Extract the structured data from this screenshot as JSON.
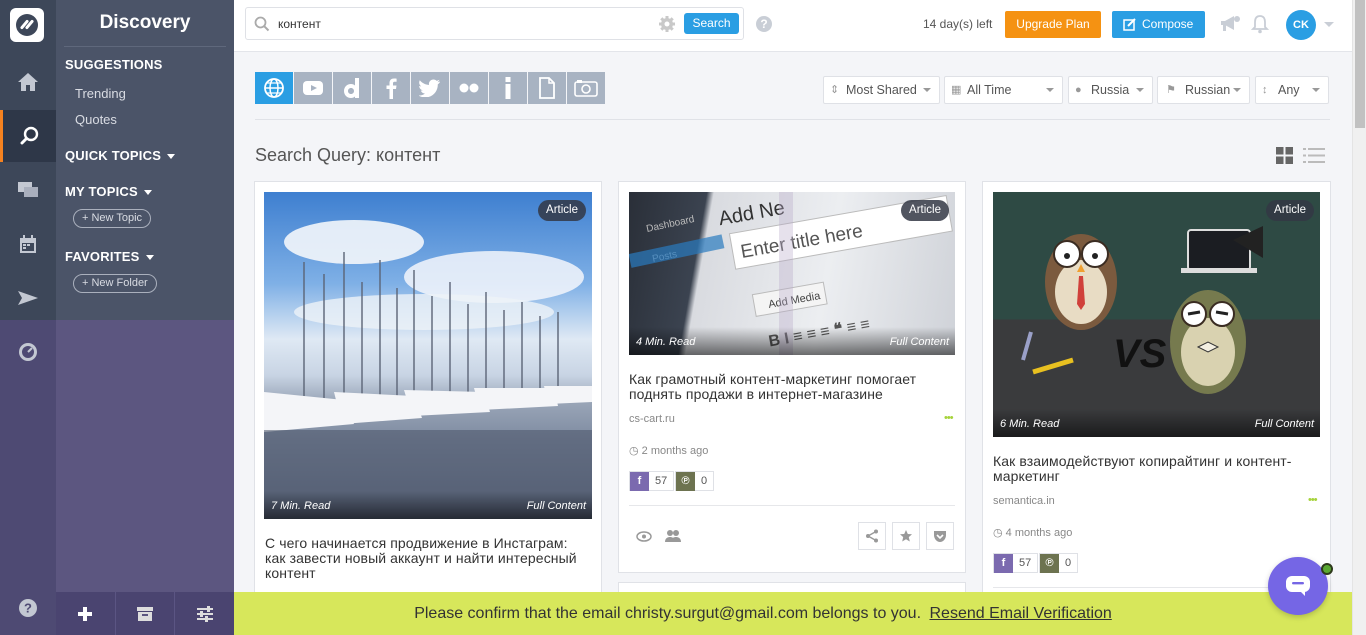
{
  "sidebar": {
    "title": "Discovery",
    "suggestions_label": "SUGGESTIONS",
    "suggestions": [
      "Trending",
      "Quotes"
    ],
    "quick_topics_label": "QUICK TOPICS",
    "my_topics_label": "MY TOPICS",
    "new_topic_label": "+ New Topic",
    "favorites_label": "FAVORITES",
    "new_folder_label": "+ New Folder"
  },
  "search": {
    "value": "контент",
    "button_label": "Search"
  },
  "header": {
    "trial_text": "14 day(s) left",
    "upgrade_label": "Upgrade Plan",
    "compose_label": "Compose",
    "avatar_initials": "CK"
  },
  "sources": [
    "web-icon",
    "youtube-icon",
    "dailymotion-icon",
    "facebook-icon",
    "twitter-icon",
    "flickr-icon",
    "info-icon",
    "document-icon",
    "instagram-icon"
  ],
  "filters": {
    "sort": "Most Shared",
    "time": "All Time",
    "region": "Russia",
    "language": "Russian",
    "length": "Any"
  },
  "query_heading": "Search Query: контент",
  "cards": [
    {
      "badge": "Article",
      "read_time": "7 Min. Read",
      "content_label": "Full Content",
      "title": "С чего начинается продвижение в Инстаграм: как завести новый аккаунт и найти интересный контент"
    },
    {
      "badge": "Article",
      "read_time": "4 Min. Read",
      "content_label": "Full Content",
      "title": "Как грамотный контент-маркетинг помогает поднять продажи в интернет-магазине",
      "domain": "cs-cart.ru",
      "time_ago": "2 months ago",
      "facebook_count": "57",
      "pinterest_count": "0",
      "image_text_1": "Add Ne",
      "image_text_2": "Enter title here",
      "image_text_3": "Add Media",
      "image_text_4": "Dashboard",
      "image_text_5": "Posts"
    },
    {
      "badge": "Article",
      "read_time": "6 Min. Read",
      "content_label": "Full Content",
      "title": "Как взаимодействуют копирайтинг и контент-маркетинг",
      "domain": "semantica.in",
      "time_ago": "4 months ago",
      "facebook_count": "57",
      "pinterest_count": "0"
    }
  ],
  "banner": {
    "text": "Please confirm that the email christy.surgut@gmail.com belongs to you.",
    "link": "Resend Email Verification"
  },
  "colors": {
    "accent": "#2a9ee3",
    "upgrade": "#f59212",
    "banner": "#d7e75b",
    "facebook": "#7b6aaf",
    "pinterest": "#6d7350"
  }
}
